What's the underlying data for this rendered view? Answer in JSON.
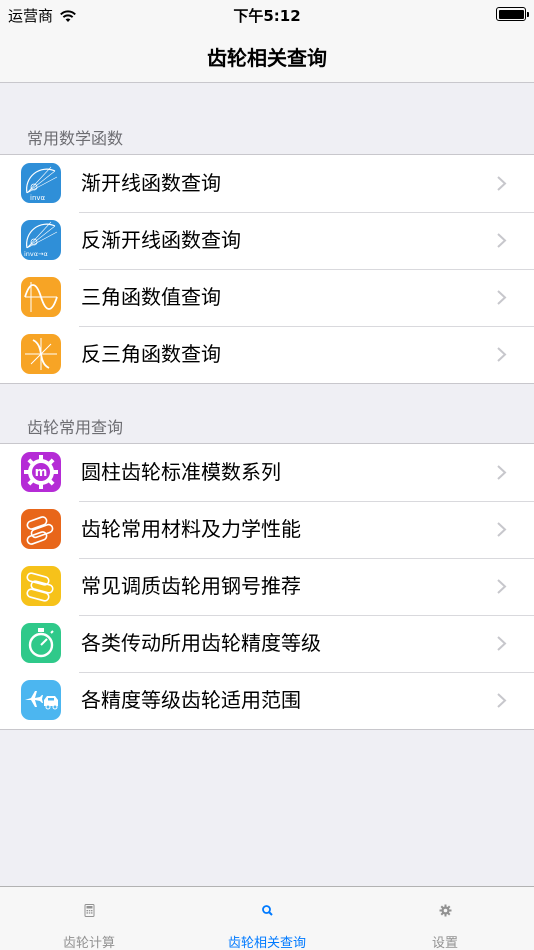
{
  "status_bar": {
    "carrier": "运营商",
    "time": "下午5:12"
  },
  "nav": {
    "title": "齿轮相关查询"
  },
  "sections": [
    {
      "header": "常用数学函数",
      "items": [
        {
          "label": "渐开线函数查询",
          "icon": "involute-function-icon",
          "icon_text": "invα",
          "color": "#2f8fd8"
        },
        {
          "label": "反渐开线函数查询",
          "icon": "inverse-involute-function-icon",
          "icon_text": "invα→α",
          "color": "#2f8fd8"
        },
        {
          "label": "三角函数值查询",
          "icon": "sine-wave-icon",
          "color": "#f7a425"
        },
        {
          "label": "反三角函数查询",
          "icon": "inverse-trig-icon",
          "color": "#f7a425"
        }
      ]
    },
    {
      "header": "齿轮常用查询",
      "items": [
        {
          "label": "圆柱齿轮标准模数系列",
          "icon": "gear-module-icon",
          "icon_text": "m",
          "color": "#b52bd6"
        },
        {
          "label": "齿轮常用材料及力学性能",
          "icon": "material-bars-icon",
          "color": "#e8661a"
        },
        {
          "label": "常见调质齿轮用钢号推荐",
          "icon": "steel-bars-icon",
          "color": "#f6c21a"
        },
        {
          "label": "各类传动所用齿轮精度等级",
          "icon": "stopwatch-icon",
          "color": "#2fc98a"
        },
        {
          "label": "各精度等级齿轮适用范围",
          "icon": "plane-car-icon",
          "color": "#4cb6f0"
        }
      ]
    }
  ],
  "tabs": [
    {
      "label": "齿轮计算",
      "icon": "calculator-icon",
      "active": false
    },
    {
      "label": "齿轮相关查询",
      "icon": "search-icon",
      "active": true
    },
    {
      "label": "设置",
      "icon": "gear-icon",
      "active": false
    }
  ],
  "colors": {
    "accent": "#007aff",
    "background": "#efeff4"
  }
}
